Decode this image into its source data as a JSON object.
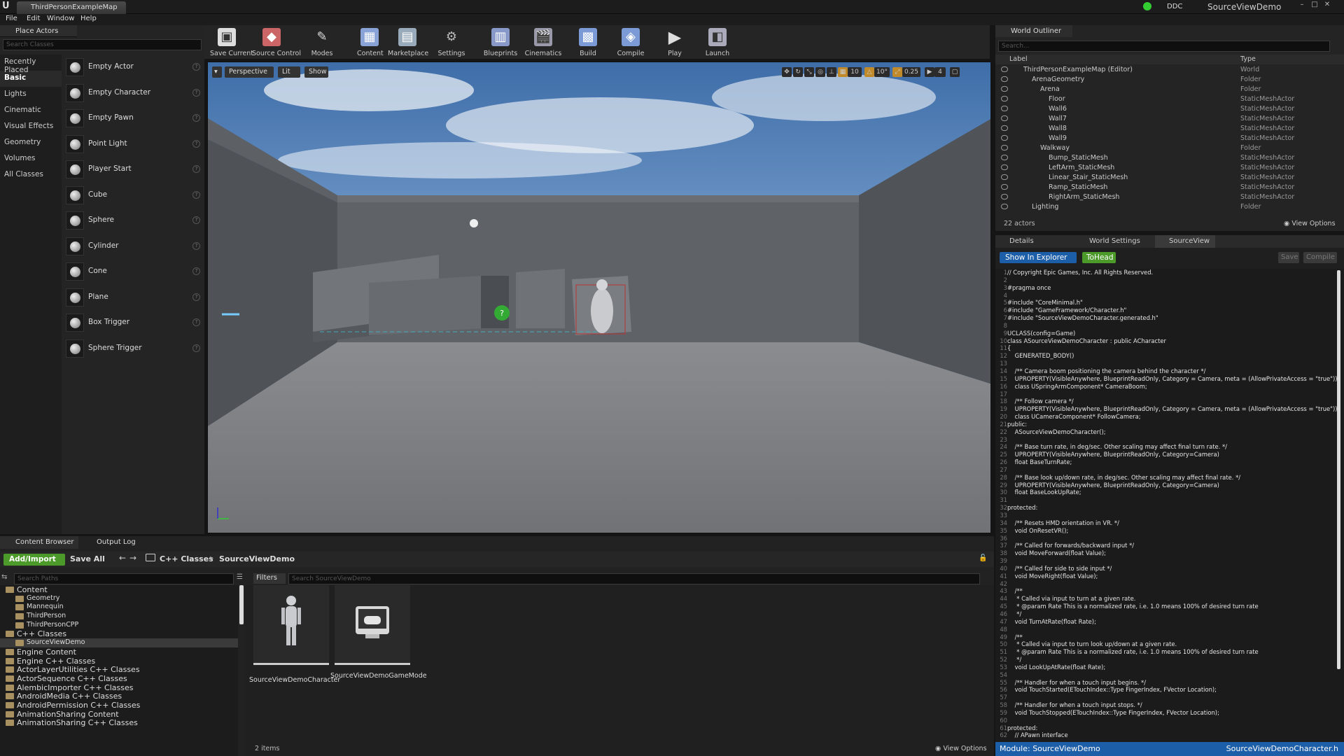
{
  "titlebar": {
    "map_tab": "ThirdPersonExampleMap",
    "ddc": "DDC",
    "project": "SourceViewDemo",
    "min": "–",
    "max": "□",
    "close": "✕"
  },
  "menu": [
    "File",
    "Edit",
    "Window",
    "Help"
  ],
  "place_actors": {
    "tab": "Place Actors",
    "search_placeholder": "Search Classes",
    "categories": [
      "Recently Placed",
      "Basic",
      "Lights",
      "Cinematic",
      "Visual Effects",
      "Geometry",
      "Volumes",
      "All Classes"
    ],
    "actors": [
      "Empty Actor",
      "Empty Character",
      "Empty Pawn",
      "Point Light",
      "Player Start",
      "Cube",
      "Sphere",
      "Cylinder",
      "Cone",
      "Plane",
      "Box Trigger",
      "Sphere Trigger"
    ]
  },
  "toolbar": {
    "items": [
      "Save Current",
      "Source Control",
      "Modes",
      "Content",
      "Marketplace",
      "Settings",
      "Blueprints",
      "Cinematics",
      "Build",
      "Compile",
      "Play",
      "Launch"
    ]
  },
  "viewport": {
    "perspective": "Perspective",
    "lit": "Lit",
    "show": "Show",
    "grid": "10",
    "angle": "10°",
    "scale": "0.25",
    "speed": "4"
  },
  "outliner": {
    "tab": "World Outliner",
    "search_placeholder": "Search...",
    "col_label": "Label",
    "col_type": "Type",
    "rows": [
      {
        "label": "ThirdPersonExampleMap (Editor)",
        "type": "World"
      },
      {
        "label": "ArenaGeometry",
        "type": "Folder"
      },
      {
        "label": "Arena",
        "type": "Folder"
      },
      {
        "label": "Floor",
        "type": "StaticMeshActor"
      },
      {
        "label": "Wall6",
        "type": "StaticMeshActor"
      },
      {
        "label": "Wall7",
        "type": "StaticMeshActor"
      },
      {
        "label": "Wall8",
        "type": "StaticMeshActor"
      },
      {
        "label": "Wall9",
        "type": "StaticMeshActor"
      },
      {
        "label": "Walkway",
        "type": "Folder"
      },
      {
        "label": "Bump_StaticMesh",
        "type": "StaticMeshActor"
      },
      {
        "label": "LeftArm_StaticMesh",
        "type": "StaticMeshActor"
      },
      {
        "label": "Linear_Stair_StaticMesh",
        "type": "StaticMeshActor"
      },
      {
        "label": "Ramp_StaticMesh",
        "type": "StaticMeshActor"
      },
      {
        "label": "RightArm_StaticMesh",
        "type": "StaticMeshActor"
      },
      {
        "label": "Lighting",
        "type": "Folder"
      }
    ],
    "count": "22 actors",
    "view_options": "View Options"
  },
  "details": {
    "tabs": [
      "Details",
      "World Settings",
      "SourceView"
    ],
    "show_in_explorer": "Show In Explorer",
    "tohead": "ToHead",
    "save": "Save",
    "compile": "Compile",
    "code": [
      "// Copyright Epic Games, Inc. All Rights Reserved.",
      "",
      "#pragma once",
      "",
      "#include \"CoreMinimal.h\"",
      "#include \"GameFramework/Character.h\"",
      "#include \"SourceViewDemoCharacter.generated.h\"",
      "",
      "UCLASS(config=Game)",
      "class ASourceViewDemoCharacter : public ACharacter",
      "{",
      "    GENERATED_BODY()",
      "",
      "    /** Camera boom positioning the camera behind the character */",
      "    UPROPERTY(VisibleAnywhere, BlueprintReadOnly, Category = Camera, meta = (AllowPrivateAccess = \"true\"))",
      "    class USpringArmComponent* CameraBoom;",
      "",
      "    /** Follow camera */",
      "    UPROPERTY(VisibleAnywhere, BlueprintReadOnly, Category = Camera, meta = (AllowPrivateAccess = \"true\"))",
      "    class UCameraComponent* FollowCamera;",
      "public:",
      "    ASourceViewDemoCharacter();",
      "",
      "    /** Base turn rate, in deg/sec. Other scaling may affect final turn rate. */",
      "    UPROPERTY(VisibleAnywhere, BlueprintReadOnly, Category=Camera)",
      "    float BaseTurnRate;",
      "",
      "    /** Base look up/down rate, in deg/sec. Other scaling may affect final rate. */",
      "    UPROPERTY(VisibleAnywhere, BlueprintReadOnly, Category=Camera)",
      "    float BaseLookUpRate;",
      "",
      "protected:",
      "",
      "    /** Resets HMD orientation in VR. */",
      "    void OnResetVR();",
      "",
      "    /** Called for forwards/backward input */",
      "    void MoveForward(float Value);",
      "",
      "    /** Called for side to side input */",
      "    void MoveRight(float Value);",
      "",
      "    /**",
      "     * Called via input to turn at a given rate.",
      "     * @param Rate This is a normalized rate, i.e. 1.0 means 100% of desired turn rate",
      "     */",
      "    void TurnAtRate(float Rate);",
      "",
      "    /**",
      "     * Called via input to turn look up/down at a given rate.",
      "     * @param Rate This is a normalized rate, i.e. 1.0 means 100% of desired turn rate",
      "     */",
      "    void LookUpAtRate(float Rate);",
      "",
      "    /** Handler for when a touch input begins. */",
      "    void TouchStarted(ETouchIndex::Type FingerIndex, FVector Location);",
      "",
      "    /** Handler for when a touch input stops. */",
      "    void TouchStopped(ETouchIndex::Type FingerIndex, FVector Location);",
      "",
      "protected:",
      "    // APawn interface"
    ],
    "status_module": "Module: SourceViewDemo",
    "status_file": "SourceViewDemoCharacter.h"
  },
  "content_browser": {
    "tabs": [
      "Content Browser",
      "Output Log"
    ],
    "add_import": "Add/Import",
    "save_all": "Save All",
    "breadcrumb": [
      "C++ Classes",
      "SourceViewDemo"
    ],
    "search_paths_placeholder": "Search Paths",
    "filters": "Filters",
    "search_assets_placeholder": "Search SourceViewDemo",
    "tree": [
      {
        "label": "Content",
        "level": 0
      },
      {
        "label": "Geometry",
        "level": 1
      },
      {
        "label": "Mannequin",
        "level": 1
      },
      {
        "label": "ThirdPerson",
        "level": 1
      },
      {
        "label": "ThirdPersonCPP",
        "level": 1
      },
      {
        "label": "C++ Classes",
        "level": 0
      },
      {
        "label": "SourceViewDemo",
        "level": 1
      },
      {
        "label": "Engine Content",
        "level": 0
      },
      {
        "label": "Engine C++ Classes",
        "level": 0
      },
      {
        "label": "ActorLayerUtilities C++ Classes",
        "level": 0
      },
      {
        "label": "ActorSequence C++ Classes",
        "level": 0
      },
      {
        "label": "AlembicImporter C++ Classes",
        "level": 0
      },
      {
        "label": "AndroidMedia C++ Classes",
        "level": 0
      },
      {
        "label": "AndroidPermission C++ Classes",
        "level": 0
      },
      {
        "label": "AnimationSharing Content",
        "level": 0
      },
      {
        "label": "AnimationSharing C++ Classes",
        "level": 0
      }
    ],
    "assets": [
      "SourceViewDemoCharacter",
      "SourceViewDemoGameMode"
    ],
    "item_count": "2 items",
    "view_options": "View Options"
  },
  "colors": {
    "accent_green": "#4c9a2a",
    "accent_blue": "#1d5ea8"
  }
}
